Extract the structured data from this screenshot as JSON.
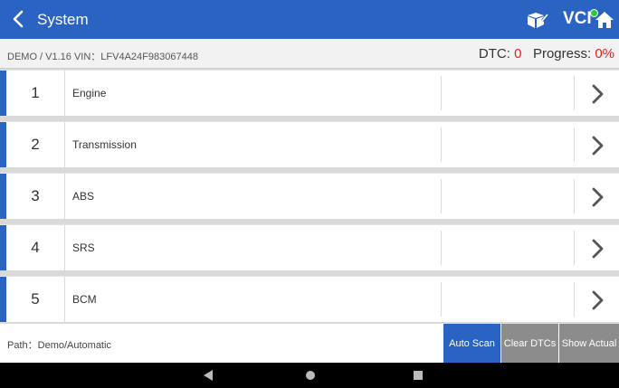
{
  "header": {
    "title": "System",
    "vci_label": "VCI",
    "accent": "#2a63c1"
  },
  "info": {
    "vehicle": "DEMO / V1.16  VIN：LFV4A24F983067448",
    "dtc_label": "DTC:",
    "dtc_value": "0",
    "progress_label": "Progress:",
    "progress_value": "0%"
  },
  "systems": [
    {
      "num": "1",
      "name": "Engine"
    },
    {
      "num": "2",
      "name": "Transmission"
    },
    {
      "num": "3",
      "name": "ABS"
    },
    {
      "num": "4",
      "name": "SRS"
    },
    {
      "num": "5",
      "name": "BCM"
    }
  ],
  "footer": {
    "path": "Path：Demo/Automatic",
    "auto_scan": "Auto Scan",
    "clear_dtcs": "Clear DTCs",
    "show_actual": "Show Actual"
  },
  "icons": {
    "back": "chevron-left-icon",
    "toolbox": "toolbox-icon",
    "home": "home-icon",
    "chevron": "chevron-right-icon"
  }
}
